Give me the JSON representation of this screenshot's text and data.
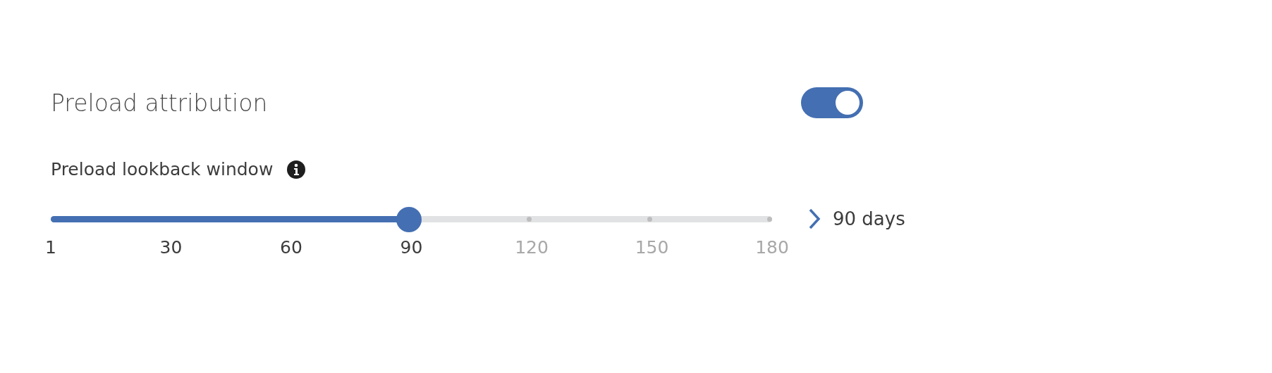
{
  "setting": {
    "title": "Preload attribution",
    "on": true
  },
  "slider": {
    "label": "Preload lookback window",
    "level": 0.497,
    "value_text": "90 days",
    "ticks": [
      {
        "label": "1",
        "reached": true
      },
      {
        "label": "30",
        "reached": true
      },
      {
        "label": "60",
        "reached": true
      },
      {
        "label": "90",
        "reached": true
      },
      {
        "label": "120",
        "reached": false
      },
      {
        "label": "150",
        "reached": false
      },
      {
        "label": "180",
        "reached": false
      }
    ]
  }
}
